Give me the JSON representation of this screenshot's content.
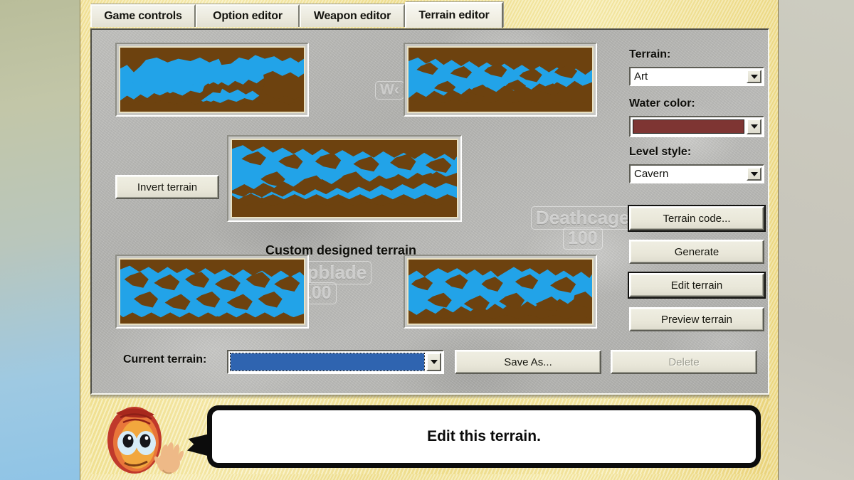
{
  "window": {
    "tabs": [
      {
        "label": "Game controls",
        "active": false
      },
      {
        "label": "Option editor",
        "active": false
      },
      {
        "label": "Weapon editor",
        "active": false
      },
      {
        "label": "Terrain editor",
        "active": true
      }
    ]
  },
  "background_hud": [
    {
      "name": "weapon-name-partial",
      "text": "W‹"
    },
    {
      "name": "weapon-name-deathcage",
      "text": "Deathcage"
    },
    {
      "name": "weapon-ammo-deathcage",
      "text": "100"
    },
    {
      "name": "weapon-name-repblade",
      "text": "epblade"
    },
    {
      "name": "weapon-ammo-repblade",
      "text": "100"
    }
  ],
  "main": {
    "caption": "Custom designed terrain",
    "invert_button": "Invert terrain",
    "current_terrain_label": "Current terrain:",
    "current_terrain_value": "",
    "save_as_button": "Save As...",
    "delete_button": "Delete",
    "thumbnails": [
      {
        "name": "terrain-thumb-top-left"
      },
      {
        "name": "terrain-thumb-top-right"
      },
      {
        "name": "terrain-thumb-center"
      },
      {
        "name": "terrain-thumb-bottom-left"
      },
      {
        "name": "terrain-thumb-bottom-right"
      }
    ]
  },
  "sidebar": {
    "terrain_label": "Terrain:",
    "terrain_value": "Art",
    "water_color_label": "Water color:",
    "water_color_value": "#7e3533",
    "level_style_label": "Level style:",
    "level_style_value": "Cavern",
    "buttons": [
      {
        "label": "Terrain code...",
        "focused": true,
        "disabled": false
      },
      {
        "label": "Generate",
        "focused": false,
        "disabled": false
      },
      {
        "label": "Edit terrain",
        "focused": true,
        "disabled": false
      },
      {
        "label": "Preview terrain",
        "focused": false,
        "disabled": false
      }
    ]
  },
  "speech": {
    "text": "Edit this terrain."
  },
  "colors": {
    "terrain_brown": "#6d420f",
    "terrain_water": "#22a3e8",
    "selection_blue": "#2f64b0",
    "water_color_swatch": "#7e3533",
    "panel_stone": "#b4b4b1",
    "frame_sand": "#f0e296"
  }
}
